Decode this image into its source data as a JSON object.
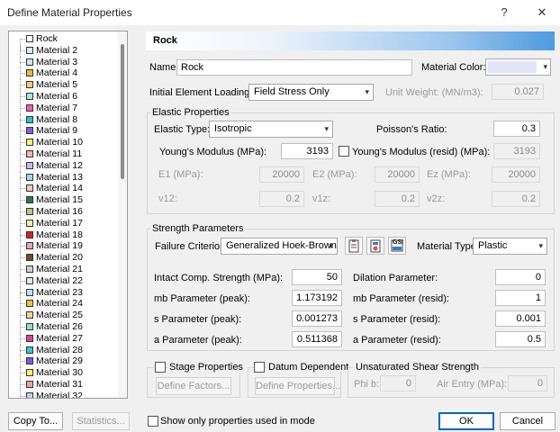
{
  "window": {
    "title": "Define Material Properties",
    "help_glyph": "?",
    "close_glyph": "✕"
  },
  "materials": [
    {
      "label": "Rock",
      "color": "#ffffff"
    },
    {
      "label": "Material 2",
      "color": "#d4f0e6"
    },
    {
      "label": "Material 3",
      "color": "#c8e8f8"
    },
    {
      "label": "Material 4",
      "color": "#f0b840"
    },
    {
      "label": "Material 5",
      "color": "#f8c880"
    },
    {
      "label": "Material 6",
      "color": "#a8e8d0"
    },
    {
      "label": "Material 7",
      "color": "#f060a0"
    },
    {
      "label": "Material 8",
      "color": "#30c0c8"
    },
    {
      "label": "Material 9",
      "color": "#8060e0"
    },
    {
      "label": "Material 10",
      "color": "#f8f080"
    },
    {
      "label": "Material 11",
      "color": "#f8b0b0"
    },
    {
      "label": "Material 12",
      "color": "#c0c0f0"
    },
    {
      "label": "Material 13",
      "color": "#a0d8f0"
    },
    {
      "label": "Material 14",
      "color": "#f0c8b8"
    },
    {
      "label": "Material 15",
      "color": "#208040"
    },
    {
      "label": "Material 16",
      "color": "#b8c878"
    },
    {
      "label": "Material 17",
      "color": "#f0f0a0"
    },
    {
      "label": "Material 18",
      "color": "#e02020"
    },
    {
      "label": "Material 19",
      "color": "#f0a0b0"
    },
    {
      "label": "Material 20",
      "color": "#705020"
    },
    {
      "label": "Material 21",
      "color": "#d0d0d0"
    },
    {
      "label": "Material 22",
      "color": "#d0f0e0"
    },
    {
      "label": "Material 23",
      "color": "#c0e0f8"
    },
    {
      "label": "Material 24",
      "color": "#f0c040"
    },
    {
      "label": "Material 25",
      "color": "#f8d0a0"
    },
    {
      "label": "Material 26",
      "color": "#90e0c0"
    },
    {
      "label": "Material 27",
      "color": "#e0409a"
    },
    {
      "label": "Material 28",
      "color": "#40c0d0"
    },
    {
      "label": "Material 29",
      "color": "#7060e8"
    },
    {
      "label": "Material 30",
      "color": "#f8f070"
    },
    {
      "label": "Material 31",
      "color": "#f0a0a0"
    },
    {
      "label": "Material 32",
      "color": "#c8c8f8"
    }
  ],
  "header": {
    "title": "Rock"
  },
  "name": {
    "label": "Name:",
    "value": "Rock"
  },
  "material_color": {
    "label": "Material Color:",
    "value": "#e4e4f8"
  },
  "initial_loading": {
    "label": "Initial Element Loading:",
    "value": "Field Stress Only"
  },
  "unit_weight": {
    "label": "Unit Weight: (MN/m3):",
    "value": "0.027"
  },
  "elastic": {
    "group_title": "Elastic Properties",
    "type_label": "Elastic Type:",
    "type_value": "Isotropic",
    "poisson_label": "Poisson's Ratio:",
    "poisson_value": "0.3",
    "youngs_label": "Young's Modulus (MPa):",
    "youngs_value": "3193",
    "youngs_resid_label": "Young's Modulus (resid) (MPa):",
    "youngs_resid_value": "3193",
    "e1_label": "E1 (MPa):",
    "e1_value": "20000",
    "e2_label": "E2 (MPa):",
    "e2_value": "20000",
    "ez_label": "Ez (MPa):",
    "ez_value": "20000",
    "v12_label": "v12:",
    "v12_value": "0.2",
    "v1z_label": "v1z:",
    "v1z_value": "0.2",
    "v2z_label": "v2z:",
    "v2z_value": "0.2"
  },
  "strength": {
    "group_title": "Strength Parameters",
    "criterion_label": "Failure Criterion:",
    "criterion_value": "Generalized Hoek-Brown",
    "material_type_label": "Material Type:",
    "material_type_value": "Plastic",
    "ucs_label": "Intact Comp. Strength (MPa):",
    "ucs_value": "50",
    "dilation_label": "Dilation Parameter:",
    "dilation_value": "0",
    "mb_peak_label": "mb Parameter (peak):",
    "mb_peak_value": "1.173192",
    "mb_resid_label": "mb Parameter (resid):",
    "mb_resid_value": "1",
    "s_peak_label": "s Parameter (peak):",
    "s_peak_value": "0.001273",
    "s_resid_label": "s Parameter (resid):",
    "s_resid_value": "0.001",
    "a_peak_label": "a Parameter (peak):",
    "a_peak_value": "0.511368",
    "a_resid_label": "a Parameter (resid):",
    "a_resid_value": "0.5",
    "gsi_label": "GSI"
  },
  "stage": {
    "label": "Stage Properties",
    "button": "Define Factors..."
  },
  "datum": {
    "label": "Datum Dependent",
    "button": "Define Properties..."
  },
  "unsaturated": {
    "group_title": "Unsaturated Shear Strength",
    "phib_label": "Phi b:",
    "phib_value": "0",
    "air_label": "Air Entry (MPa):",
    "air_value": "0"
  },
  "footer": {
    "copy_to": "Copy To...",
    "statistics": "Statistics...",
    "show_only": "Show only properties used in mode",
    "ok": "OK",
    "cancel": "Cancel"
  }
}
